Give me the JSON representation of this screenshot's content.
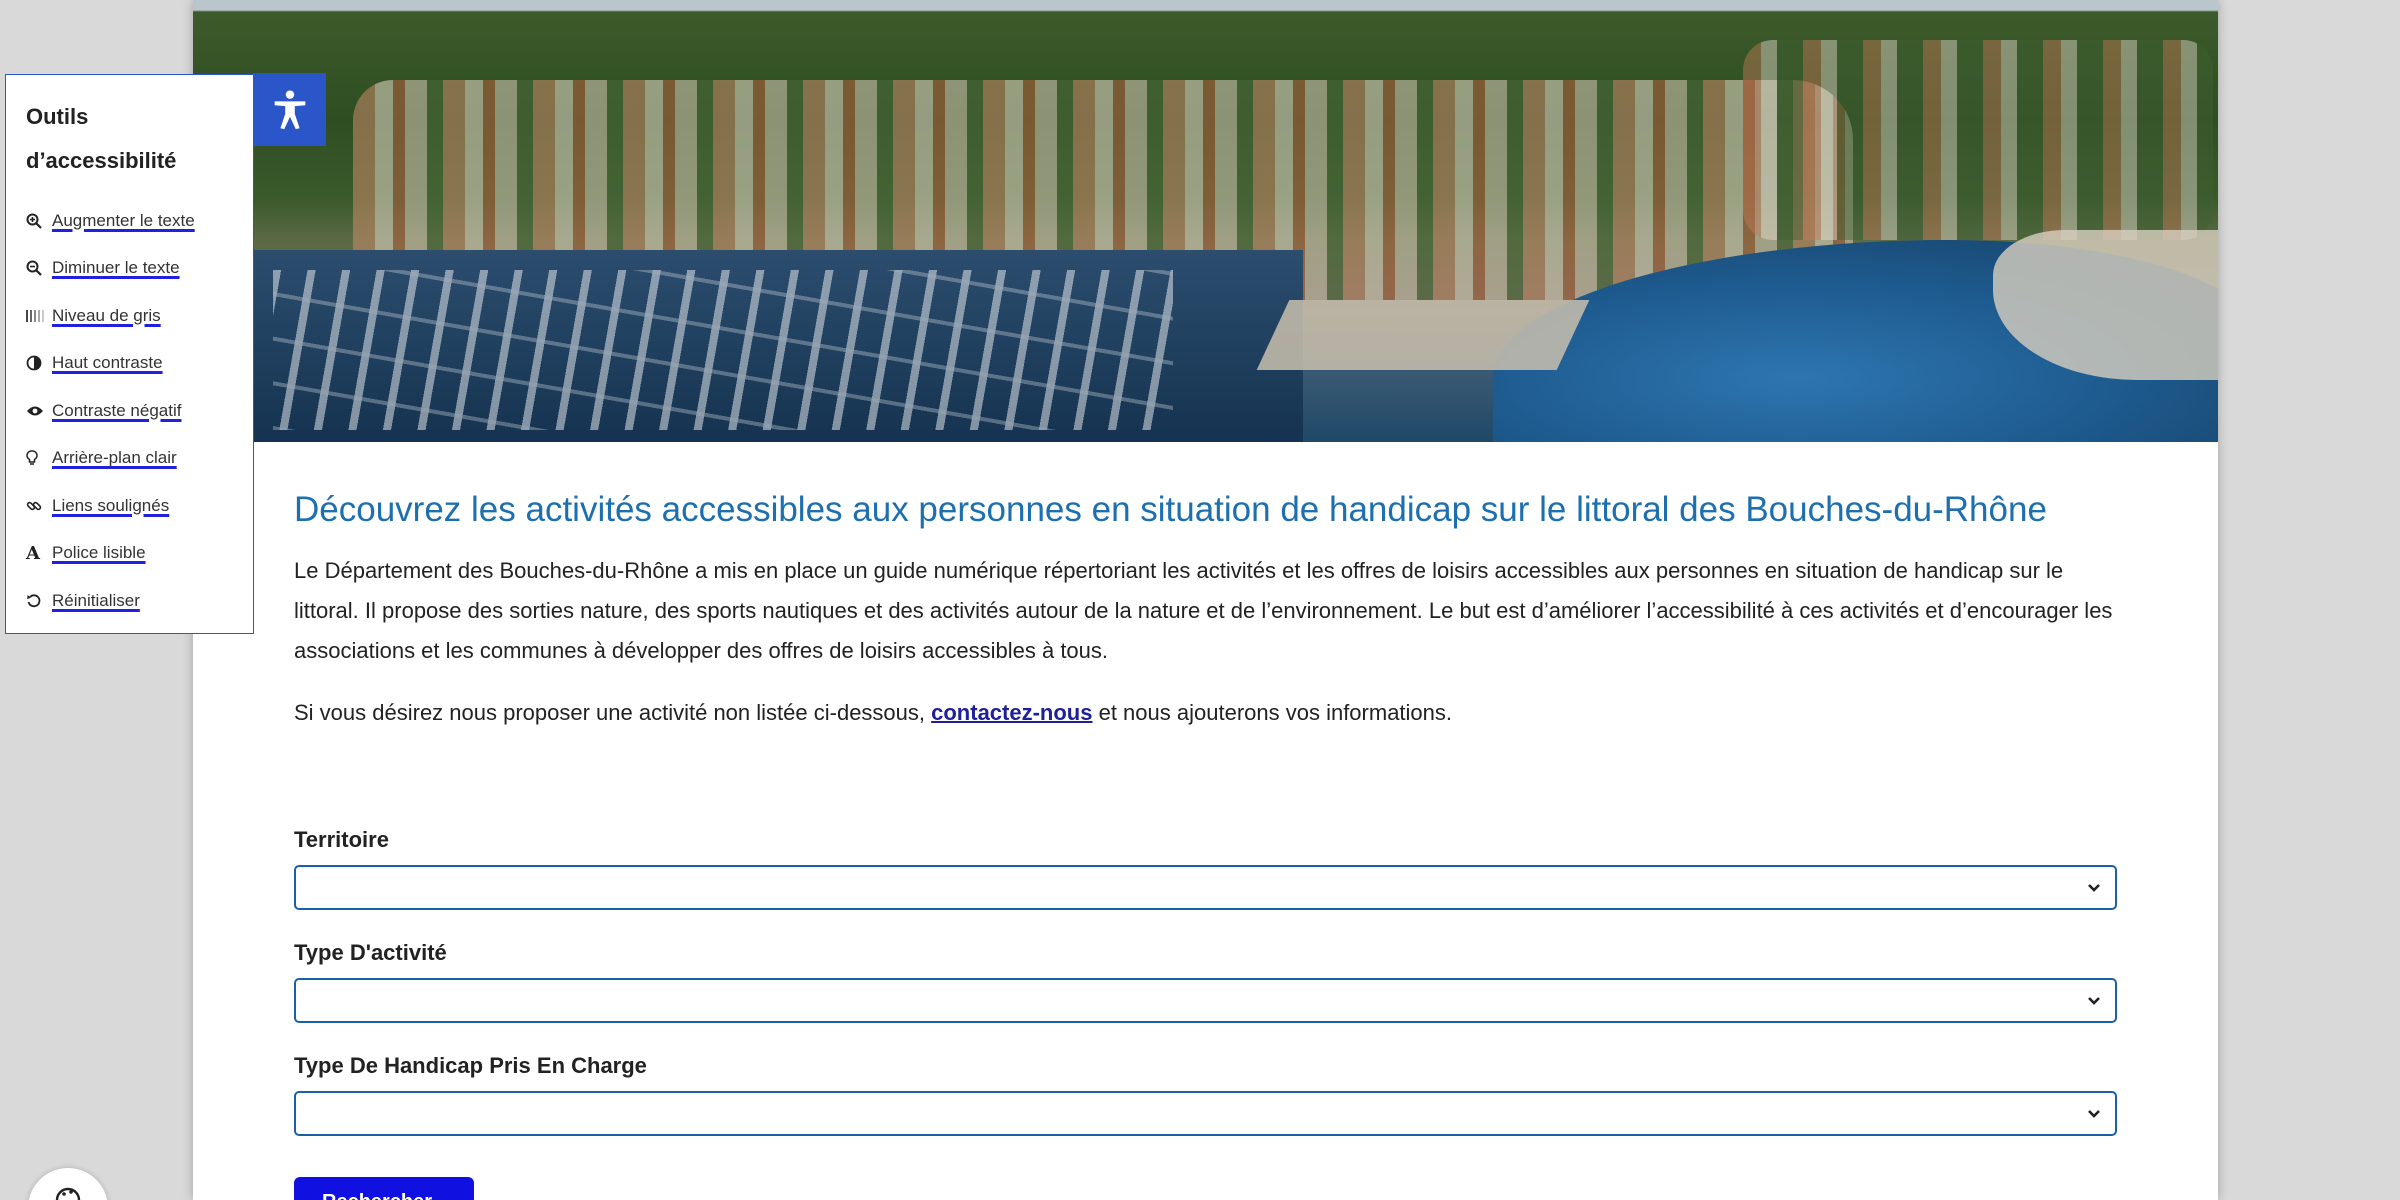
{
  "accessibility": {
    "title_line1": "Outils",
    "title_line2": "d’accessibilité",
    "items": [
      {
        "label": "Augmenter le texte",
        "icon": "zoom-in-icon"
      },
      {
        "label": "Diminuer le texte",
        "icon": "zoom-out-icon"
      },
      {
        "label": "Niveau de gris",
        "icon": "grayscale-icon"
      },
      {
        "label": "Haut contraste",
        "icon": "contrast-icon"
      },
      {
        "label": "Contraste négatif",
        "icon": "eye-icon"
      },
      {
        "label": "Arrière-plan clair",
        "icon": "lightbulb-icon"
      },
      {
        "label": "Liens soulignés",
        "icon": "link-icon"
      },
      {
        "label": "Police lisible",
        "icon": "font-icon"
      },
      {
        "label": " Réinitialiser",
        "icon": "reset-icon"
      }
    ],
    "toggle_icon": "accessibility-person-icon"
  },
  "main": {
    "title": "Découvrez les activités accessibles aux personnes en situation de handicap sur le littoral des Bouches-du-Rhône",
    "intro": "Le Département des Bouches-du-Rhône a mis en place un guide numérique répertoriant les activités et les offres de loisirs accessibles aux personnes en situation de handicap sur le littoral. Il propose des sorties nature, des sports nautiques et des activités autour de la nature et de l’environnement. Le but est d’améliorer l’accessibilité à ces activités et d’encourager les associations et les communes à développer des offres de loisirs accessibles à tous.",
    "contact_before": "Si vous désirez nous proposer une activité non listée ci-dessous, ",
    "contact_link": "contactez-nous",
    "contact_after": " et nous ajouterons vos informations."
  },
  "filters": [
    {
      "label": "Territoire",
      "value": ""
    },
    {
      "label": "Type D'activité",
      "value": ""
    },
    {
      "label": "Type De Handicap Pris En Charge",
      "value": ""
    }
  ],
  "search_button": "Rechercher",
  "colors": {
    "accent": "#1d6fb0",
    "panel_border": "#2b56c9",
    "button": "#1010e0"
  }
}
